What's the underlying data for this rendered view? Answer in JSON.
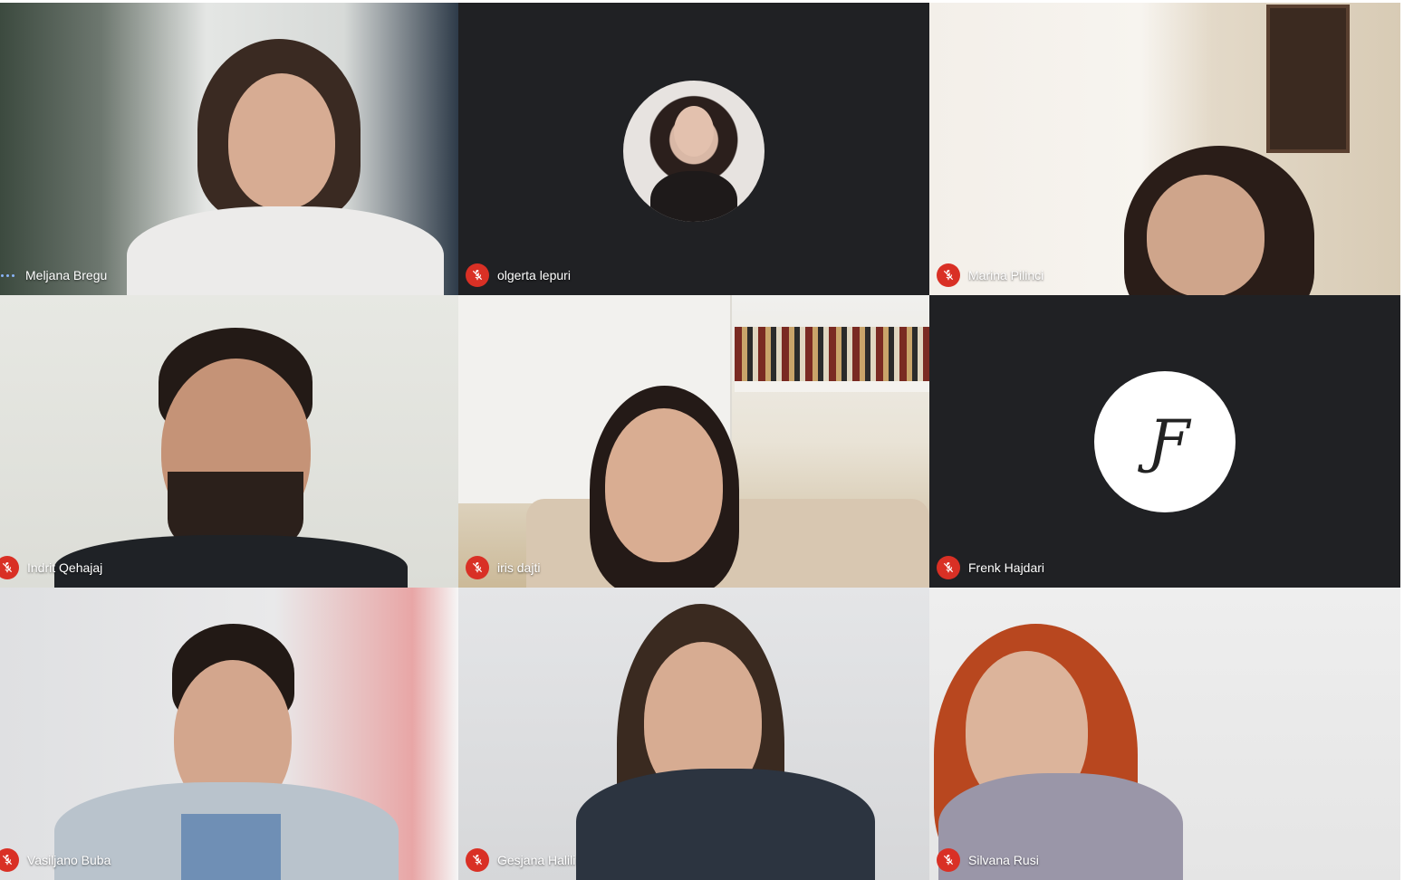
{
  "meeting": {
    "participants": [
      {
        "name": "Meljana Bregu",
        "muted": false,
        "speaking": true,
        "video": "camera"
      },
      {
        "name": "olgerta lepuri",
        "muted": true,
        "speaking": false,
        "video": "avatar-photo"
      },
      {
        "name": "Marina Pilinci",
        "muted": true,
        "speaking": false,
        "video": "camera"
      },
      {
        "name": "Indrit Qehajaj",
        "muted": true,
        "speaking": false,
        "video": "camera"
      },
      {
        "name": "iris dajti",
        "muted": true,
        "speaking": false,
        "video": "camera"
      },
      {
        "name": "Frenk Hajdari",
        "muted": true,
        "speaking": false,
        "video": "avatar-logo"
      },
      {
        "name": "Vasiljano Buba",
        "muted": true,
        "speaking": false,
        "video": "camera"
      },
      {
        "name": "Gesjana Halili",
        "muted": true,
        "speaking": false,
        "video": "camera"
      },
      {
        "name": "Silvana Rusi",
        "muted": true,
        "speaking": false,
        "video": "camera"
      }
    ],
    "frenk_avatar_monogram": "Ƒ",
    "colors": {
      "tile_background": "#202124",
      "mic_off": "#d93025",
      "speaking_indicator": "#8ab4f8",
      "name_text": "#ffffff"
    },
    "icons": {
      "muted": "mic-off-icon",
      "speaking": "speaking-indicator-icon"
    }
  }
}
